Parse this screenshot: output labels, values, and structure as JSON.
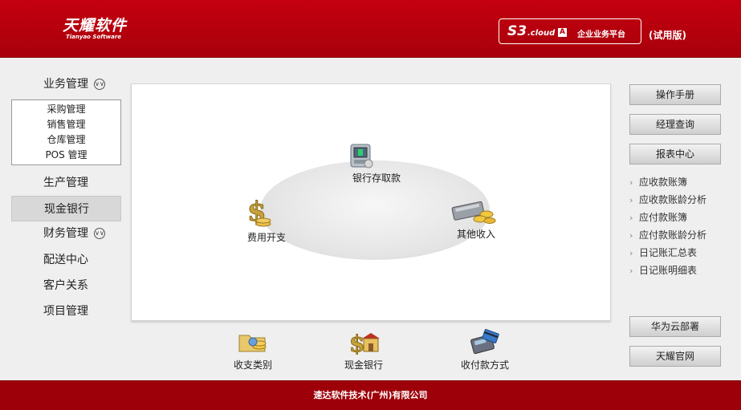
{
  "header": {
    "logo_cn": "天耀软件",
    "logo_en": "Tianyao Software",
    "platform_s3": "S3",
    "platform_cloud": ".cloud",
    "platform_badge": "A",
    "platform_name": "企业业务平台",
    "trial": "(试用版)"
  },
  "left_menu": {
    "business": "业务管理",
    "submenu": [
      "采购管理",
      "销售管理",
      "仓库管理",
      "POS 管理"
    ],
    "production": "生产管理",
    "cash_bank": "现金银行",
    "finance": "财务管理",
    "delivery": "配送中心",
    "customer": "客户关系",
    "project": "项目管理"
  },
  "main": {
    "bank_deposit": "银行存取款",
    "expense": "费用开支",
    "other_income": "其他收入"
  },
  "bottom": {
    "category": "收支类别",
    "cash_bank": "现金银行",
    "payment_method": "收付款方式"
  },
  "right": {
    "manual": "操作手册",
    "manager_query": "经理查询",
    "report_center": "报表中心",
    "reports": [
      "应收款账簿",
      "应收款账龄分析",
      "应付款账簿",
      "应付款账龄分析",
      "日记账汇总表",
      "日记账明细表"
    ],
    "huawei_cloud": "华为云部署",
    "official_site": "天耀官网"
  },
  "footer": {
    "company": "速达软件技术(广州)有限公司"
  },
  "colors": {
    "brand_red": "#b3000f",
    "footer_red": "#9e0009"
  }
}
